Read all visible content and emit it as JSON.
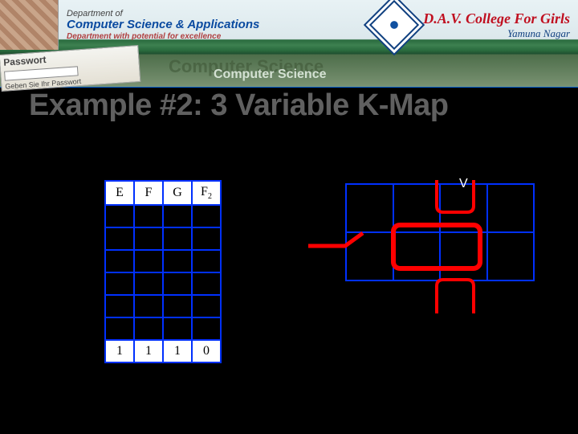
{
  "banner": {
    "dept_small": "Department of",
    "dept_title": "Computer Science & Applications",
    "dept_sub": "Department with potential for excellence",
    "college_title": "D.A.V. College For Girls",
    "college_sub": "Yamuna Nagar",
    "cs1": "Computer Science",
    "cs2": "Computer Science",
    "passwort_label": "Passwort",
    "passwort_hint": "Geben Sie Ihr Passwort"
  },
  "title": "Example #2: 3 Variable K-Map",
  "truth_table": {
    "headers": [
      "E",
      "F",
      "G",
      "F2"
    ],
    "sub": "2",
    "last_row": [
      "1",
      "1",
      "1",
      "0"
    ]
  },
  "kmap": {
    "label_v": "V"
  }
}
